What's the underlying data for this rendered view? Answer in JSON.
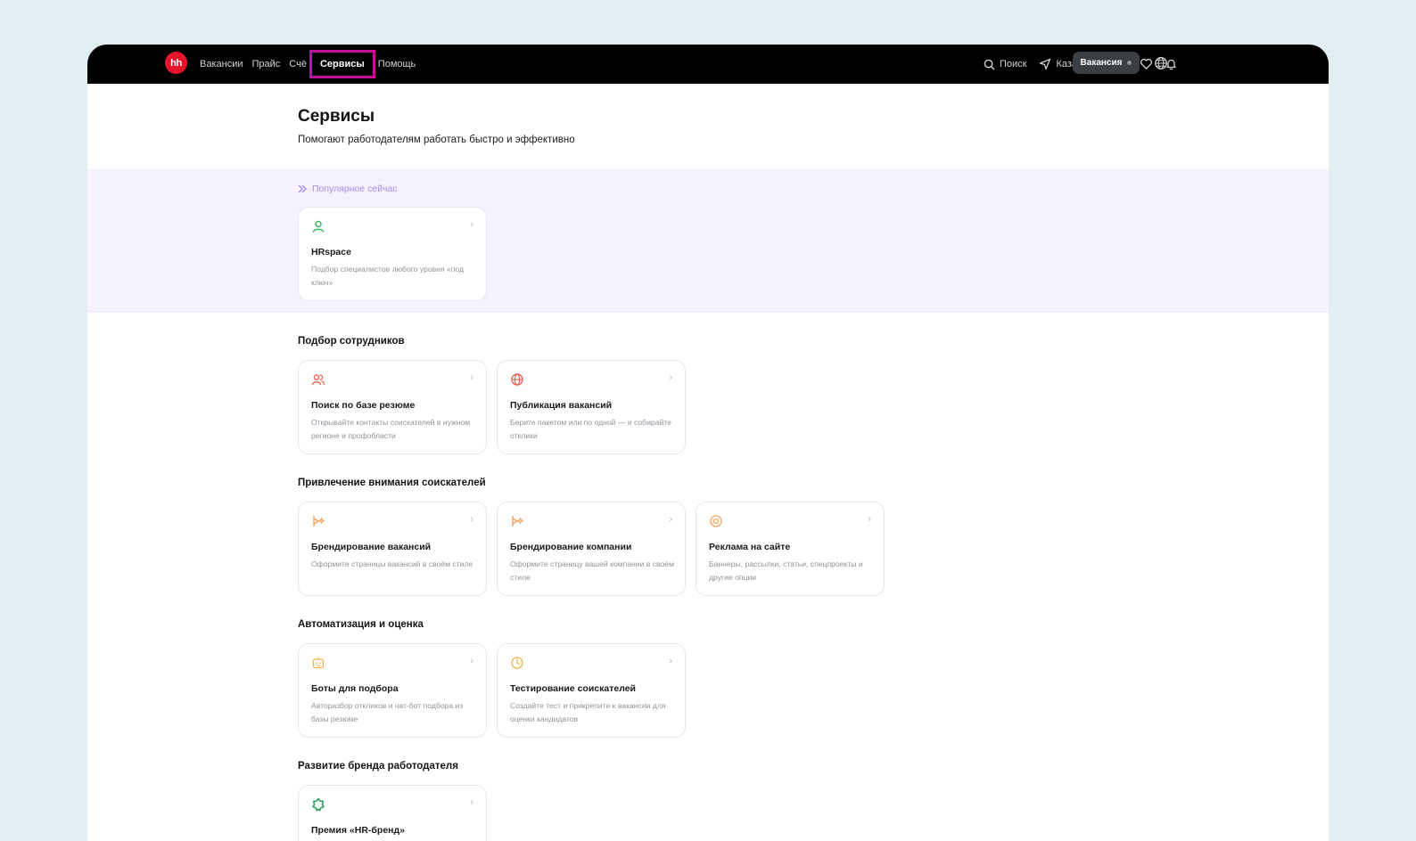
{
  "nav": {
    "logo": "hh",
    "items": [
      {
        "label": "Вакансии"
      },
      {
        "label": "Прайс"
      },
      {
        "label": "Счё"
      },
      {
        "label": "Сервисы",
        "active": true
      },
      {
        "label": "Помощь"
      }
    ],
    "search_label": "Поиск",
    "region_label": "Казахстан",
    "vacancy_button": "Вакансия"
  },
  "page": {
    "title": "Сервисы",
    "subtitle": "Помогают работодателям работать быстро и эффективно"
  },
  "popular": {
    "label": "Популярное сейчас",
    "cards": [
      {
        "title": "HRspace",
        "desc": "Подбор специалистов любого уровня «под ключ»",
        "icon": "person-icon",
        "color": "#3dbb64"
      }
    ]
  },
  "sections": [
    {
      "title": "Подбор сотрудников",
      "cards": [
        {
          "title": "Поиск по базе резюме",
          "desc": "Открывайте контакты соискателей в нужном регионе и профобласти",
          "icon": "users-icon",
          "color": "#f0645a"
        },
        {
          "title": "Публикация вакансий",
          "desc": "Берите пакетом или по одной — и собирайте отклики",
          "icon": "globe-icon",
          "color": "#f0645a"
        }
      ]
    },
    {
      "title": "Привлечение внимания соискателей",
      "cards": [
        {
          "title": "Брендирование вакансий",
          "desc": "Оформите страницы вакансий в своём стиле",
          "icon": "sparkle-icon",
          "color": "#f7a35c"
        },
        {
          "title": "Брендирование компании",
          "desc": "Оформите страницу вашей компании в своём стиле",
          "icon": "sparkle-icon",
          "color": "#f7a35c"
        },
        {
          "title": "Реклама на сайте",
          "desc": "Баннеры, рассылки, статьи, спецпроекты и другие опции",
          "icon": "target-icon",
          "color": "#f7a35c"
        }
      ]
    },
    {
      "title": "Автоматизация и оценка",
      "cards": [
        {
          "title": "Боты для подбора",
          "desc": "Авторазбор откликов и чат-бот подбора из базы резюме",
          "icon": "bot-icon",
          "color": "#f5b04c"
        },
        {
          "title": "Тестирование соискателей",
          "desc": "Создайте тест и прикрепите к вакансии для оценки кандидатов",
          "icon": "clock-icon",
          "color": "#f5b04c"
        }
      ]
    },
    {
      "title": "Развитие бренда работодателя",
      "cards": [
        {
          "title": "Премия «HR-бренд»",
          "desc": "",
          "icon": "flower-icon",
          "color": "#2aa35a"
        }
      ]
    }
  ]
}
